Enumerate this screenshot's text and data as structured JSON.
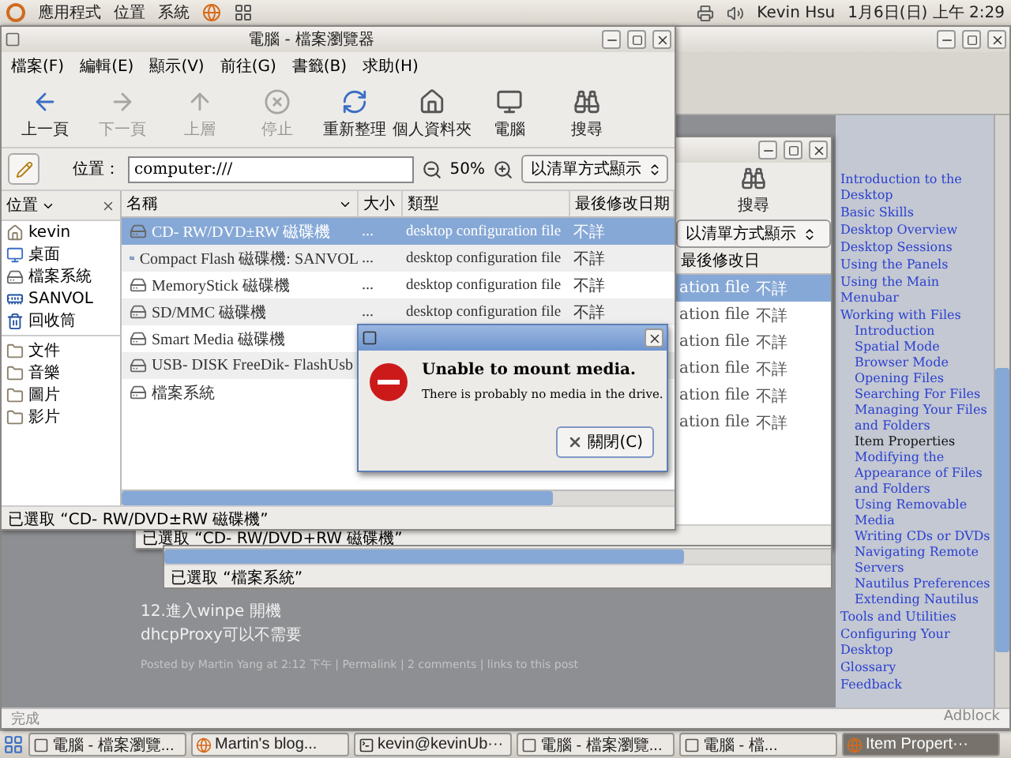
{
  "top_panel": {
    "menus": [
      "應用程式",
      "位置",
      "系統"
    ],
    "user": "Kevin Hsu",
    "clock": "1月6日(日) 上午 2:29"
  },
  "browser": {
    "blog_lines": [
      "12.進入winpe 開機",
      "dhcpProxy可以不需要"
    ],
    "post_footer": "Posted by Martin Yang at 2:12 下午 | Permalink | 2 comments | links to this post",
    "status": "完成",
    "adblock": "Adblock",
    "help_toc": [
      {
        "label": "Introduction to the Desktop",
        "selected": false
      },
      {
        "label": "Basic Skills",
        "selected": false
      },
      {
        "label": "Desktop Overview",
        "selected": false
      },
      {
        "label": "Desktop Sessions",
        "selected": false
      },
      {
        "label": "Using the Panels",
        "selected": false
      },
      {
        "label": "Using the Main Menubar",
        "selected": false
      },
      {
        "label": "Working with Files",
        "selected": false,
        "children": [
          {
            "label": "Introduction",
            "selected": false
          },
          {
            "label": "Spatial Mode",
            "selected": false
          },
          {
            "label": "Browser Mode",
            "selected": false
          },
          {
            "label": "Opening Files",
            "selected": false
          },
          {
            "label": "Searching For Files",
            "selected": false
          },
          {
            "label": "Managing Your Files and Folders",
            "selected": false
          },
          {
            "label": "Item Properties",
            "selected": true
          },
          {
            "label": "Modifying the Appearance of Files and Folders",
            "selected": false
          },
          {
            "label": "Using Removable Media",
            "selected": false
          },
          {
            "label": "Writing CDs or DVDs",
            "selected": false
          },
          {
            "label": "Navigating Remote Servers",
            "selected": false
          },
          {
            "label": "Nautilus Preferences",
            "selected": false
          },
          {
            "label": "Extending Nautilus",
            "selected": false
          }
        ]
      },
      {
        "label": "Tools and Utilities",
        "selected": false
      },
      {
        "label": "Configuring Your Desktop",
        "selected": false
      },
      {
        "label": "Glossary",
        "selected": false
      },
      {
        "label": "Feedback",
        "selected": false
      }
    ]
  },
  "back_window": {
    "search": "搜尋",
    "view_mode": "以清單方式顯示",
    "column": "最後修改日",
    "rows": [
      {
        "type": "ation file",
        "date": "不詳",
        "selected": true
      },
      {
        "type": "ation file",
        "date": "不詳",
        "selected": false
      },
      {
        "type": "ation file",
        "date": "不詳",
        "selected": false
      },
      {
        "type": "ation file",
        "date": "不詳",
        "selected": false
      },
      {
        "type": "ation file",
        "date": "不詳",
        "selected": false
      },
      {
        "type": "ation file",
        "date": "不詳",
        "selected": false
      }
    ],
    "status": "已選取 “CD- RW/DVD+RW 磁碟機”"
  },
  "back_window_2": {
    "status": "已選取 “檔案系統”"
  },
  "file_manager": {
    "title": "電腦 - 檔案瀏覽器",
    "menu": [
      "檔案(F)",
      "編輯(E)",
      "顯示(V)",
      "前往(G)",
      "書籤(B)",
      "求助(H)"
    ],
    "toolbar": [
      {
        "kind": "back",
        "label": "上一頁",
        "disabled": false
      },
      {
        "kind": "forward",
        "label": "下一頁",
        "disabled": true
      },
      {
        "kind": "up",
        "label": "上層",
        "disabled": true
      },
      {
        "kind": "stop",
        "label": "停止",
        "disabled": true
      },
      {
        "kind": "reload",
        "label": "重新整理",
        "disabled": false
      },
      {
        "kind": "home",
        "label": "個人資料夾",
        "disabled": false
      },
      {
        "kind": "computer",
        "label": "電腦",
        "disabled": false
      },
      {
        "kind": "search",
        "label": "搜尋",
        "disabled": false
      }
    ],
    "location_label": "位置：",
    "location": "computer:///",
    "zoom": "50%",
    "view_mode": "以清單方式顯示",
    "sidebar_title": "位置",
    "places": [
      {
        "kind": "home",
        "label": "kevin"
      },
      {
        "kind": "desktop",
        "label": "桌面"
      },
      {
        "kind": "drive",
        "label": "檔案系統"
      },
      {
        "kind": "card",
        "label": "SANVOL"
      },
      {
        "kind": "trash",
        "label": "回收筒"
      }
    ],
    "bookmarks": [
      {
        "kind": "folder",
        "label": "文件"
      },
      {
        "kind": "folder",
        "label": "音樂"
      },
      {
        "kind": "folder",
        "label": "圖片"
      },
      {
        "kind": "folder",
        "label": "影片"
      }
    ],
    "columns": [
      "名稱",
      "大小",
      "類型",
      "最後修改日期"
    ],
    "rows": [
      {
        "kind": "drive",
        "name": "CD- RW/DVD±RW 磁碟機",
        "size": "...",
        "type": "desktop configuration file",
        "date": "不詳",
        "selected": true
      },
      {
        "kind": "card",
        "name": "Compact Flash 磁碟機: SANVOL",
        "size": "...",
        "type": "desktop configuration file",
        "date": "不詳",
        "selected": false
      },
      {
        "kind": "drive",
        "name": "MemoryStick 磁碟機",
        "size": "...",
        "type": "desktop configuration file",
        "date": "不詳",
        "selected": false
      },
      {
        "kind": "drive",
        "name": "SD/MMC 磁碟機",
        "size": "...",
        "type": "desktop configuration file",
        "date": "不詳",
        "selected": false
      },
      {
        "kind": "drive",
        "name": "Smart Media 磁碟機",
        "selected": false
      },
      {
        "kind": "drive",
        "name": "USB- DISK FreeDik- FlashUsb",
        "selected": false
      },
      {
        "kind": "drive",
        "name": "檔案系統",
        "selected": false
      }
    ],
    "status": "已選取 “CD- RW/DVD±RW 磁碟機”"
  },
  "dialog": {
    "heading": "Unable to mount media.",
    "message": "There is probably no media in the drive.",
    "button": "關閉(C)"
  },
  "taskbar": {
    "items": [
      {
        "kind": "files",
        "label": "電腦 - 檔案瀏覽...",
        "selected": false
      },
      {
        "kind": "browser",
        "label": "Martin's blog...",
        "selected": false
      },
      {
        "kind": "terminal",
        "label": "kevin@kevinUb···",
        "selected": false
      },
      {
        "kind": "files",
        "label": "電腦 - 檔案瀏覽...",
        "selected": false
      },
      {
        "kind": "files",
        "label": "電腦 - 檔...",
        "selected": false
      },
      {
        "kind": "browser",
        "label": "Item Propert···",
        "selected": true
      }
    ]
  }
}
